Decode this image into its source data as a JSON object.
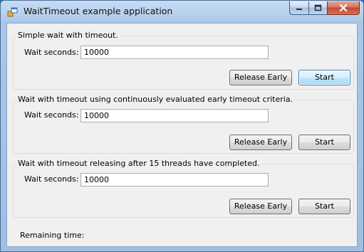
{
  "window": {
    "title": "WaitTimeout example application",
    "caption_buttons": [
      "minimize",
      "maximize",
      "close"
    ]
  },
  "groups": [
    {
      "title": "Simple wait with timeout.",
      "wait_label": "Wait seconds:",
      "wait_value": "10000",
      "release_label": "Release Early",
      "start_label": "Start"
    },
    {
      "title": "Wait with timeout using continuously evaluated early timeout criteria.",
      "wait_label": "Wait seconds:",
      "wait_value": "10000",
      "release_label": "Release Early",
      "start_label": "Start"
    },
    {
      "title": "Wait with timeout releasing after 15 threads have completed.",
      "wait_label": "Wait seconds:",
      "wait_value": "10000",
      "release_label": "Release Early",
      "start_label": "Start"
    }
  ],
  "status": {
    "remaining_label": "Remaining time:"
  }
}
